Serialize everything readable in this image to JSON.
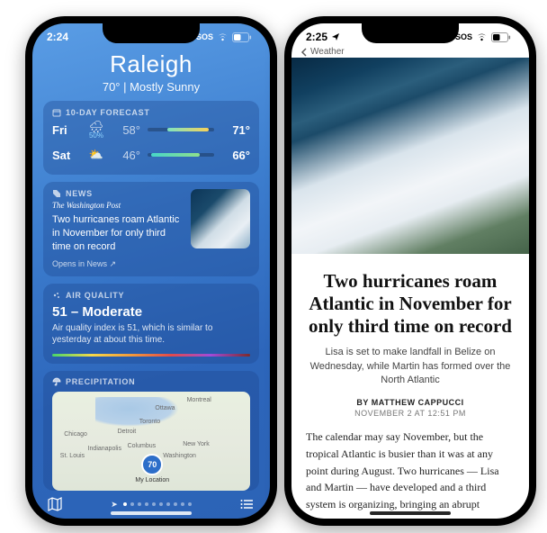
{
  "left": {
    "status": {
      "time": "2:24",
      "sos": "SOS",
      "batt": "46"
    },
    "city": "Raleigh",
    "condition": "70°  |  Mostly Sunny",
    "forecast": {
      "header": "10-DAY FORECAST",
      "rows": [
        {
          "day": "Fri",
          "precip": "50%",
          "lo": "58°",
          "hi": "71°"
        },
        {
          "day": "Sat",
          "precip": "",
          "lo": "46°",
          "hi": "66°"
        }
      ]
    },
    "news": {
      "header": "NEWS",
      "source": "The Washington Post",
      "headline": "Two hurricanes roam Atlantic in November for only third time on record",
      "open": "Opens in News ↗"
    },
    "aqi": {
      "header": "AIR QUALITY",
      "value": "51 – Moderate",
      "desc": "Air quality index is 51, which is similar to yesterday at about this time."
    },
    "precip": {
      "header": "PRECIPITATION"
    },
    "map": {
      "loc_temp": "70",
      "loc_label": "My Location",
      "cities": [
        "Montreal",
        "Ottawa",
        "Toronto",
        "Chicago",
        "Detroit",
        "Indianapolis",
        "New York",
        "St. Louis",
        "Washington",
        "Columbus"
      ]
    }
  },
  "right": {
    "status": {
      "time": "2:25",
      "sos": "SOS",
      "batt": "46"
    },
    "back": "Weather",
    "title": "Two hurricanes roam Atlantic in November for only third time on record",
    "subtitle": "Lisa is set to make landfall in Belize on Wednesday, while Martin has formed over the North Atlantic",
    "byline": "BY MATTHEW CAPPUCCI",
    "dateline": "NOVEMBER 2 AT 12:51 PM",
    "body": "The calendar may say November, but the tropical Atlantic is busier than it was at any point during August. Two hurricanes — Lisa and Martin — have developed and a third system is organizing, bringing an abrupt"
  }
}
